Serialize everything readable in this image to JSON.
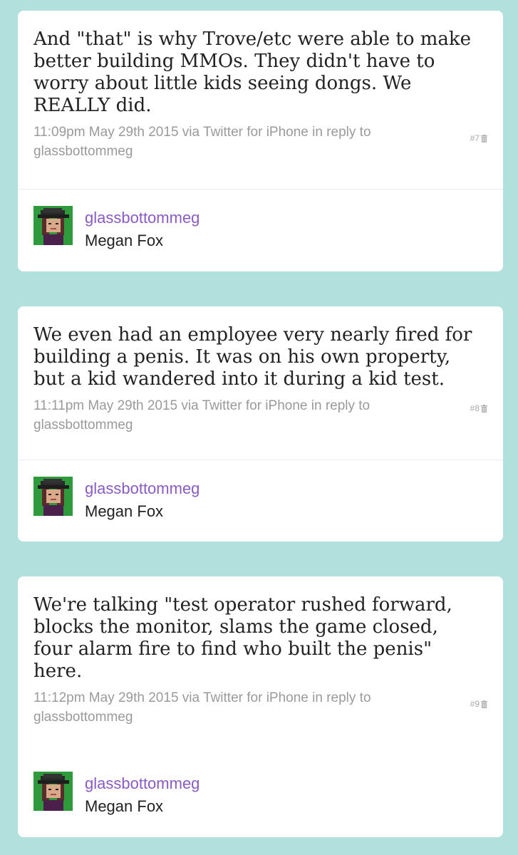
{
  "tweets": [
    {
      "text": "And \"that\" is why Trove/etc were able to make better building MMOs. They didn't have to worry about little kids seeing dongs. We REALLY did.",
      "time": "11:09pm May 29th 2015",
      "via_label": "via",
      "client": "Twitter for iPhone",
      "reply_label": "in reply to",
      "reply_to": "glassbottommeg",
      "number": "#7",
      "author_username": "glassbottommeg",
      "author_name": "Megan Fox"
    },
    {
      "text": "We even had an employee very nearly fired for building a penis. It was on his own property, but a kid wandered into it during a kid test.",
      "time": "11:11pm May 29th 2015",
      "via_label": "via",
      "client": "Twitter for iPhone",
      "reply_label": "in reply to",
      "reply_to": "glassbottommeg",
      "number": "#8",
      "author_username": "glassbottommeg",
      "author_name": "Megan Fox"
    },
    {
      "text": "We're talking \"test operator rushed forward, blocks the monitor, slams the game closed, four alarm fire to find who built the penis\" here.",
      "time": "11:12pm May 29th 2015",
      "via_label": "via",
      "client": "Twitter for iPhone",
      "reply_label": "in reply to",
      "reply_to": "glassbottommeg",
      "number": "#9",
      "author_username": "glassbottommeg",
      "author_name": "Megan Fox"
    }
  ],
  "icons": {
    "delete": "trash-icon",
    "avatar": "avatar"
  },
  "colors": {
    "background": "#b2e0dc",
    "card": "#ffffff",
    "username": "#8a5bc4",
    "meta": "#9a9a9a",
    "text": "#222222"
  }
}
